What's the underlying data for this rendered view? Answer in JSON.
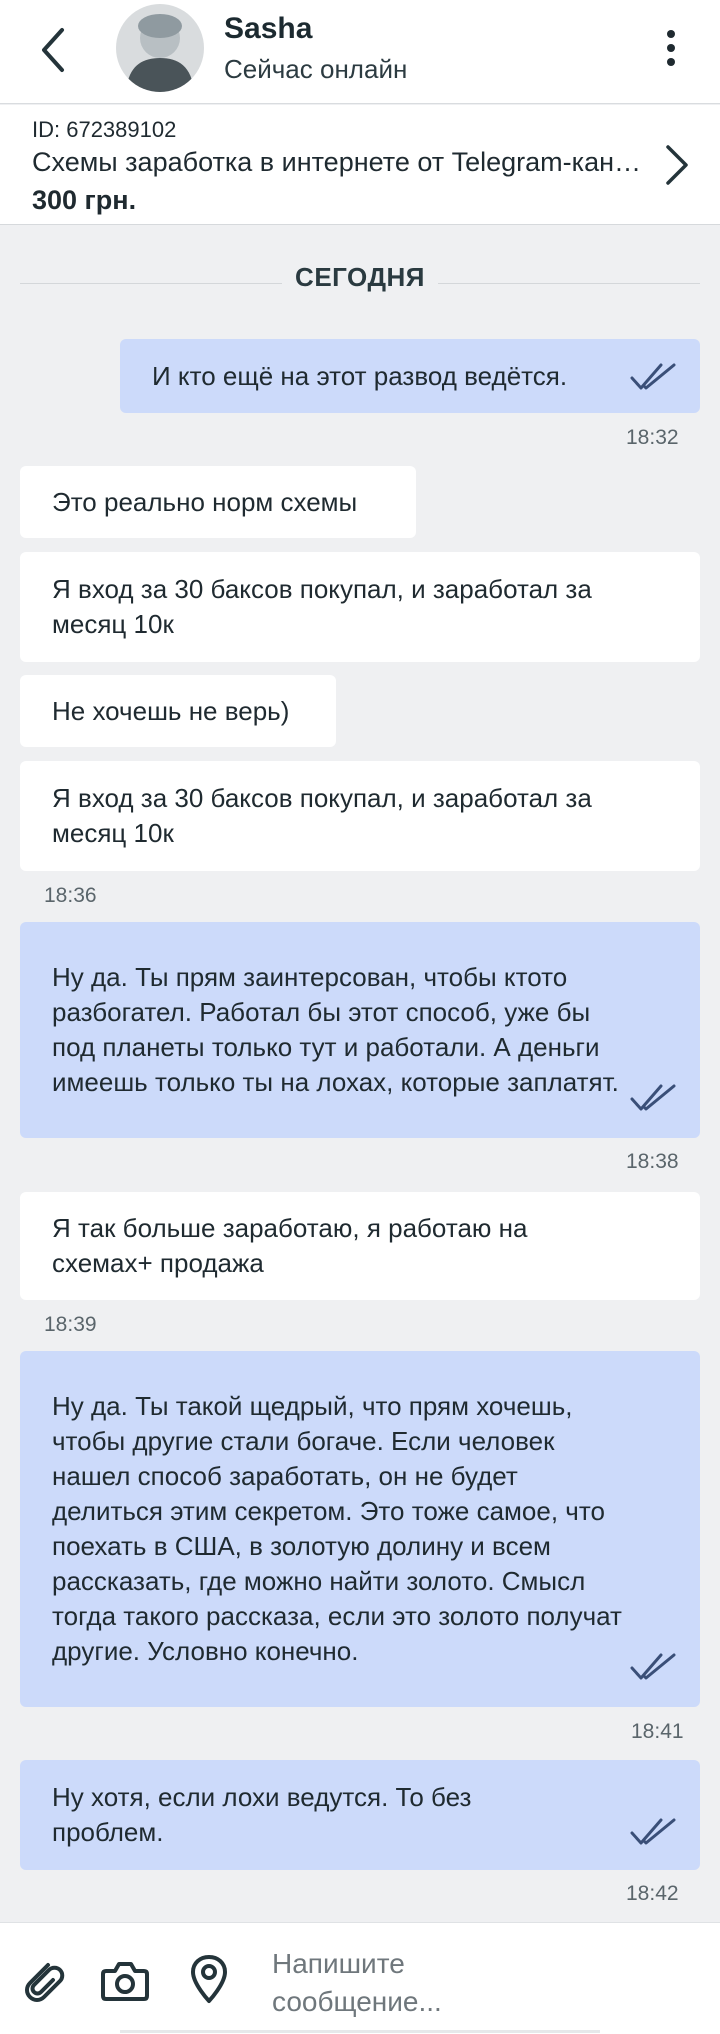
{
  "header": {
    "contact_name": "Sasha",
    "contact_status": "Сейчас онлайн",
    "back_icon": "chevron-left-icon",
    "more_icon": "more-vertical-icon"
  },
  "ad": {
    "id_text": "ID: 672389102",
    "title": "Схемы заработка в интернете от Telegram-канала",
    "price": "300 грн."
  },
  "chat": {
    "date_label": "СЕГОДНЯ",
    "messages": [
      {
        "dir": "out",
        "text": "И кто ещё на этот развод ведётся.",
        "time": "18:32",
        "read": true
      },
      {
        "dir": "in",
        "text": "Это реально норм схемы"
      },
      {
        "dir": "in",
        "text": "Я вход за 30 баксов покупал, и заработал за месяц 10к"
      },
      {
        "dir": "in",
        "text": "Не хочешь не верь)"
      },
      {
        "dir": "in",
        "text": "Я вход за 30 баксов покупал, и заработал за месяц 10к",
        "time": "18:36"
      },
      {
        "dir": "out",
        "text": "Ну да. Ты прям заинтерсован, чтобы ктото разбогател. Работал бы этот способ, уже бы под планеты только тут и работали. А деньги имеешь только ты на лохах, которые заплатят.",
        "time": "18:38",
        "read": true
      },
      {
        "dir": "in",
        "text": "Я так больше заработаю, я работаю на схемах+ продажа",
        "time": "18:39"
      },
      {
        "dir": "out",
        "text": "Ну да. Ты такой щедрый, что прям хочешь, чтобы другие стали богаче. Если человек нашел способ заработать, он не будет делиться этим секретом. Это тоже самое, что поехать в США, в золотую долину и всем рассказать, где можно найти золото. Смысл тогда такого рассказа, если это золото получат другие. Условно конечно.",
        "time": "18:41",
        "read": true
      },
      {
        "dir": "out",
        "text": "Ну хотя, если лохи ведутся. То без проблем.",
        "time": "18:42",
        "read": true
      }
    ]
  },
  "input": {
    "placeholder": "Напишите сообщение...",
    "attach_icon": "paperclip-icon",
    "camera_icon": "camera-icon",
    "location_icon": "location-pin-icon"
  },
  "colors": {
    "incoming_bubble": "#ffffff",
    "outgoing_bubble": "#ccdafa",
    "background": "#eff0f2",
    "read_checks": "#3a4f78"
  }
}
